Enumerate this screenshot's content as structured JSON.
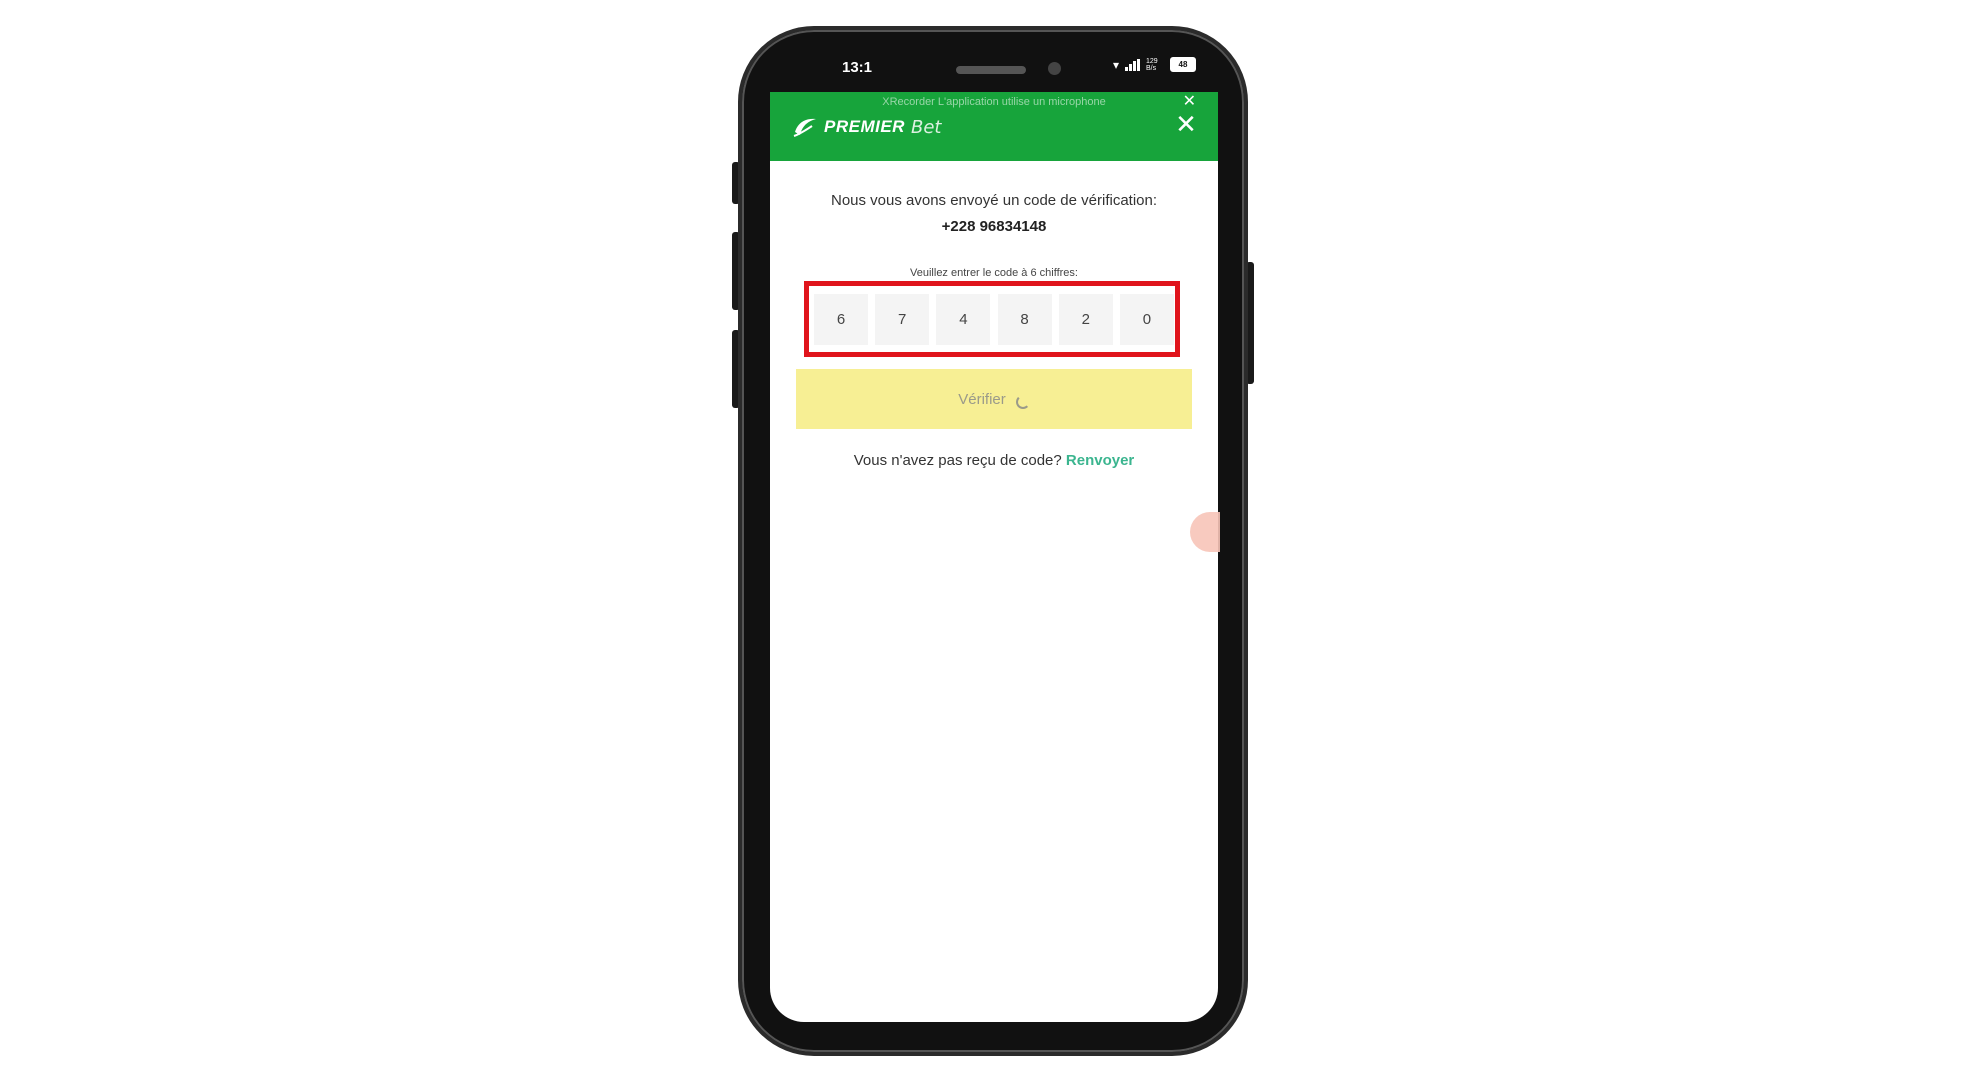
{
  "status_bar": {
    "time": "13:1",
    "network_speed": "129 B/s",
    "battery": "48"
  },
  "header": {
    "banner_text": "XRecorder L'application utilise un microphone",
    "logo_primary": "PREMIER",
    "logo_secondary": "Bet",
    "close_symbol": "✕",
    "banner_close_symbol": "✕"
  },
  "verification": {
    "sent_message": "Nous vous avons envoyé un code de vérification:",
    "phone_number": "+228 96834148",
    "code_label": "Veuillez entrer le code à 6 chiffres:",
    "digits": [
      "6",
      "7",
      "4",
      "8",
      "2",
      "0"
    ],
    "verify_label": "Vérifier",
    "resend_prompt": "Vous n'avez pas reçu de code?",
    "resend_link": "Renvoyer"
  },
  "colors": {
    "header_green": "#17a43b",
    "highlight_red": "#e0141c",
    "verify_yellow": "#f7ef94",
    "link_teal": "#3bb58f"
  }
}
